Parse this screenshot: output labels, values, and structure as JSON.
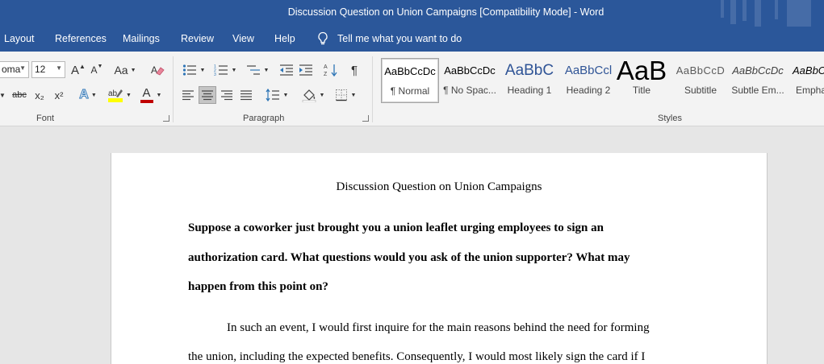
{
  "window": {
    "title": "Discussion Question on Union Campaigns [Compatibility Mode]  -  Word"
  },
  "tabs": [
    {
      "label": "Layout"
    },
    {
      "label": "References"
    },
    {
      "label": "Mailings"
    },
    {
      "label": "Review"
    },
    {
      "label": "View"
    },
    {
      "label": "Help"
    }
  ],
  "tellme": {
    "label": "Tell me what you want to do"
  },
  "ribbon": {
    "font": {
      "font_name": "oma",
      "font_size": "12",
      "grow_font": "A",
      "shrink_font": "A",
      "change_case": "Aa",
      "strikethrough": "abc",
      "subscript": "x₂",
      "superscript": "x²",
      "text_effects": "A",
      "font_color": "A",
      "group_label": "Font"
    },
    "paragraph": {
      "show_marks": "¶",
      "group_label": "Paragraph"
    },
    "styles": {
      "group_label": "Styles",
      "items": [
        {
          "sample": "AaBbCcDc",
          "name": "¶ Normal"
        },
        {
          "sample": "AaBbCcDc",
          "name": "¶ No Spac..."
        },
        {
          "sample": "AaBbC",
          "name": "Heading 1"
        },
        {
          "sample": "AaBbCcl",
          "name": "Heading 2"
        },
        {
          "sample": "AaB",
          "name": "Title"
        },
        {
          "sample": "AaBbCcD",
          "name": "Subtitle"
        },
        {
          "sample": "AaBbCcDc",
          "name": "Subtle Em..."
        },
        {
          "sample": "AaBbCcDc",
          "name": "Empha"
        }
      ]
    }
  },
  "document": {
    "title": "Discussion Question on Union Campaigns",
    "question_lines": [
      "Suppose a coworker just brought you a union leaflet urging employees to sign an",
      "authorization card. What questions would you ask of the union supporter? What may",
      "happen from this point on?"
    ],
    "body_lines": [
      "In such an event, I would first inquire for the main reasons behind the need for forming",
      "the union, including the expected benefits. Consequently, I would most likely sign the card if I"
    ]
  },
  "colors": {
    "title_bar": "#2b579a",
    "ribbon": "#f3f3f3",
    "canvas": "#e6e6e6",
    "heading_blue": "#2f5496",
    "font_color_red": "#c00000",
    "highlight_yellow": "#ffff00"
  }
}
